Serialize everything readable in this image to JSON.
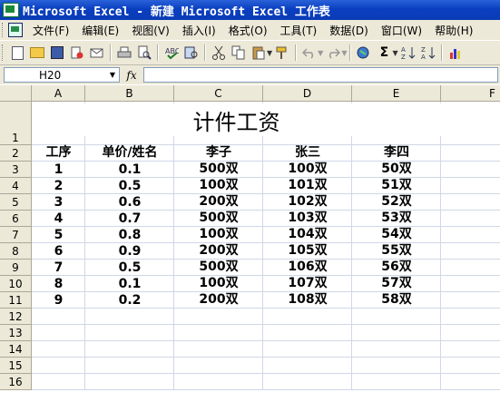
{
  "window": {
    "title": "Microsoft Excel - 新建 Microsoft Excel 工作表"
  },
  "menu": [
    "文件(F)",
    "编辑(E)",
    "视图(V)",
    "插入(I)",
    "格式(O)",
    "工具(T)",
    "数据(D)",
    "窗口(W)",
    "帮助(H)"
  ],
  "toolbar": {
    "icons": [
      "new-icon",
      "open-icon",
      "save-icon",
      "permission-icon",
      "email-icon",
      "print-icon",
      "print-preview-icon",
      "spelling-icon",
      "research-icon",
      "cut-icon",
      "copy-icon",
      "paste-icon",
      "format-painter-icon",
      "undo-icon",
      "redo-icon",
      "hyperlink-icon",
      "autosum-icon",
      "sort-asc-icon",
      "sort-desc-icon",
      "chart-wizard-icon"
    ],
    "autosum_label": "Σ",
    "fx_label": "fx"
  },
  "name_box": {
    "value": "H20"
  },
  "formula": {
    "value": ""
  },
  "columns": [
    "A",
    "B",
    "C",
    "D",
    "E",
    "F"
  ],
  "rows": [
    "1",
    "2",
    "3",
    "4",
    "5",
    "6",
    "7",
    "8",
    "9",
    "10",
    "11",
    "12",
    "13",
    "14",
    "15",
    "16"
  ],
  "sheet": {
    "title": "计件工资",
    "headers": [
      "工序",
      "单价/姓名",
      "李子",
      "张三",
      "李四"
    ],
    "data": [
      [
        "1",
        "0.1",
        "500双",
        "100双",
        "50双"
      ],
      [
        "2",
        "0.5",
        "100双",
        "101双",
        "51双"
      ],
      [
        "3",
        "0.6",
        "200双",
        "102双",
        "52双"
      ],
      [
        "4",
        "0.7",
        "500双",
        "103双",
        "53双"
      ],
      [
        "5",
        "0.8",
        "100双",
        "104双",
        "54双"
      ],
      [
        "6",
        "0.9",
        "200双",
        "105双",
        "55双"
      ],
      [
        "7",
        "0.5",
        "500双",
        "106双",
        "56双"
      ],
      [
        "8",
        "0.1",
        "100双",
        "107双",
        "57双"
      ],
      [
        "9",
        "0.2",
        "200双",
        "108双",
        "58双"
      ]
    ]
  }
}
